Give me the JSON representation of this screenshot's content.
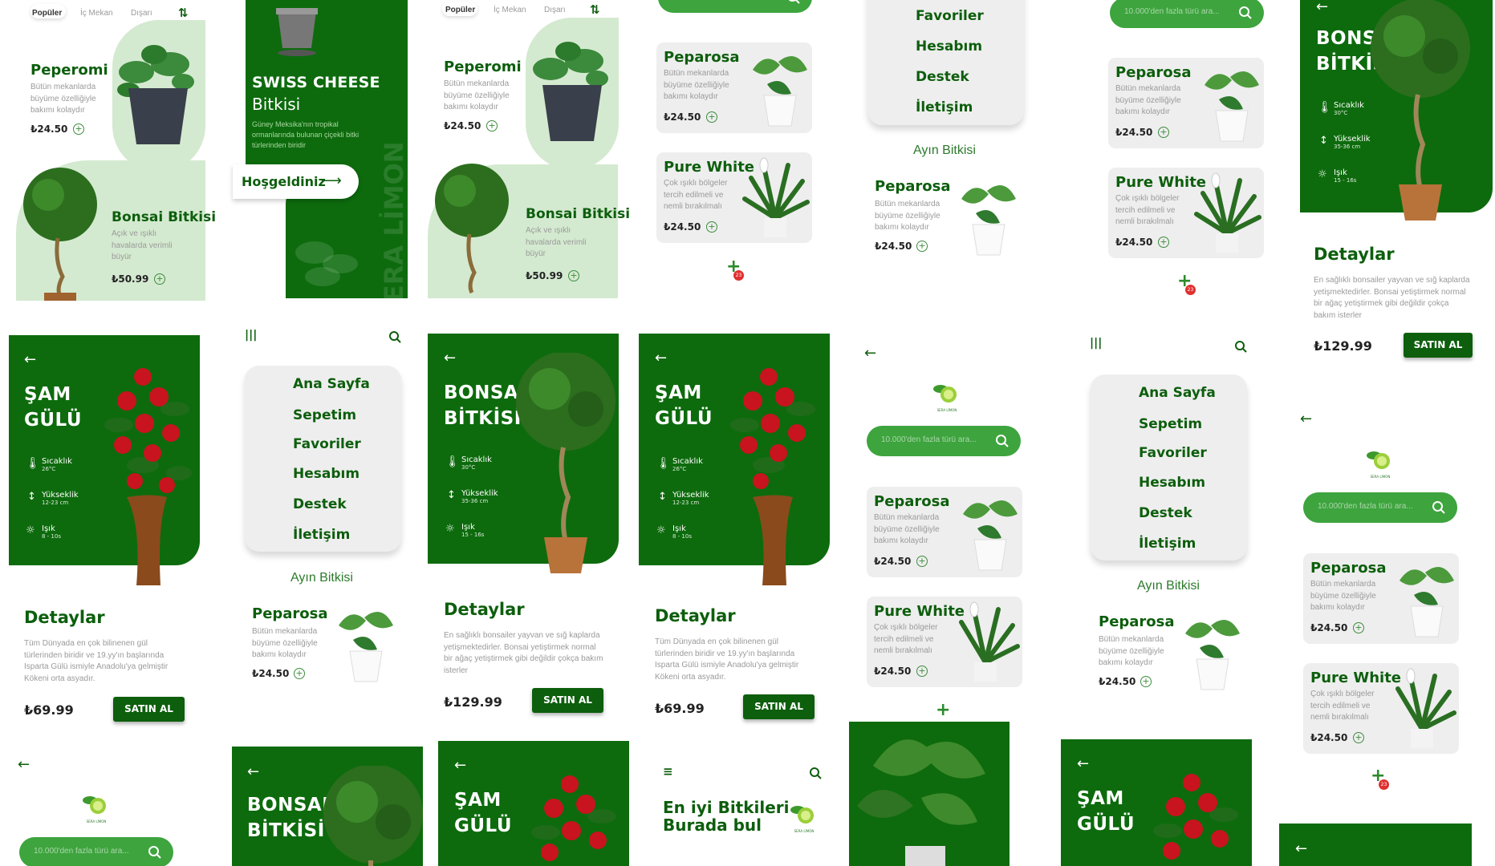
{
  "tabs": {
    "popular": "Popüler",
    "indoor": "İç Mekan",
    "outdoor": "Dışarı"
  },
  "products": {
    "peperomi": {
      "name": "Peperomi",
      "desc": "Bütün mekanlarda büyüme özelliğiyle bakımı kolaydır",
      "price": "₺24.50"
    },
    "bonsai": {
      "name": "Bonsai Bitkisi",
      "desc": "Açık ve ışıklı havalarda verimli büyür",
      "price": "₺50.99"
    },
    "peparosa": {
      "name": "Peparosa",
      "desc": "Bütün mekanlarda büyüme özelliğiyle bakımı kolaydır",
      "price": "₺24.50"
    },
    "purewhite": {
      "name": "Pure White",
      "desc": "Çok ışıklı bölgeler tercih edilmeli ve nemli bırakılmalı",
      "price": "₺24.50"
    }
  },
  "welcome": {
    "title": "SWISS CHEESE",
    "subtitle": "Bitkisi",
    "desc": "Güney Meksika'nın tropikal ormanlarında bulunan çiçekli bitki türlerinden biridir",
    "button": "Hoşgeldiniz",
    "watermark": "SERA LİMON"
  },
  "menu": [
    "Ana Sayfa",
    "Sepetim",
    "Favoriler",
    "Hesabım",
    "Destek",
    "İletişim"
  ],
  "month_plant": "Ayın Bitkisi",
  "search_placeholder": "10.000'den fazla türü ara...",
  "brand": "SERA LİMON",
  "cart_badge": "23",
  "details": {
    "heading": "Detaylar",
    "buy": "SATIN AL",
    "temp_label": "Sıcaklık",
    "height_label": "Yükseklik",
    "light_label": "Işık",
    "bonsai": {
      "title1": "BONSAI",
      "title2": "BİTKİSİ",
      "temp": "30°C",
      "height": "35-36 cm",
      "light": "15 - 16s",
      "desc": "En sağlıklı bonsailer yayvan ve sığ kaplarda yetişmektedirler. Bonsai yetiştirmek normal bir ağaç yetiştirmek gibi değildir çokça bakım isterler",
      "price": "₺129.99",
      "watermark": "BONSAI BİTKİSİ"
    },
    "rose": {
      "title1": "ŞAM",
      "title2": "GÜLÜ",
      "temp": "26°C",
      "height": "12-23 cm",
      "light": "8 - 10s",
      "desc": "Tüm Dünyada en çok bilinenen gül türlerinden biridir ve 19.yy'ın başlarında Isparta Gülü ismiyle Anadolu'ya gelmiştir Kökeni orta asyadır.",
      "price": "₺69.99",
      "watermark": "ŞAM"
    }
  },
  "home_heading": {
    "line1": "En iyi Bitkileri",
    "line2": "Burada bul"
  },
  "colors": {
    "green": "#0d6b0d",
    "dark": "#0d5e0d",
    "light": "#3ea43e",
    "badge": "#e03030"
  }
}
